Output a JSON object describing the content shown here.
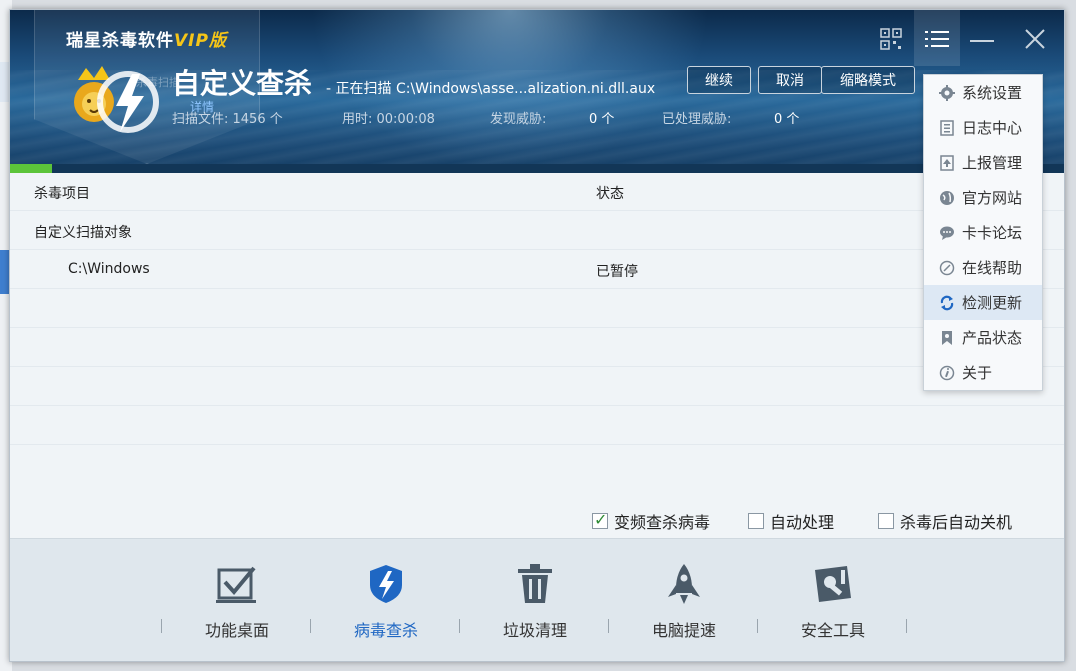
{
  "app": {
    "brand": "瑞星杀毒软件",
    "brand_vip": "VIP版",
    "hidden_text": "杀毒扫描",
    "detail_link": "详情"
  },
  "scan": {
    "title": "自定义查杀",
    "path": "- 正在扫描 C:\\Windows\\asse...alization.ni.dll.aux",
    "files_label": "扫描文件: 1456 个",
    "time_label": "用时: 00:00:08",
    "threats_found_label": "发现威胁:",
    "threats_found_value": "0 个",
    "threats_handled_label": "已处理威胁:",
    "threats_handled_value": "0 个",
    "progress_fraction": 0.04
  },
  "buttons": {
    "continue": "继续",
    "cancel": "取消",
    "mini_mode": "缩略模式"
  },
  "table": {
    "col_item": "杀毒项目",
    "col_status": "状态",
    "rows": [
      {
        "item": "自定义扫描对象",
        "status": ""
      },
      {
        "item": "C:\\Windows",
        "status": "已暂停"
      }
    ]
  },
  "options": {
    "freq": "变频查杀病毒",
    "auto_handle": "自动处理",
    "auto_shutdown": "杀毒后自动关机"
  },
  "nav": [
    {
      "label": "功能桌面",
      "icon": "checkbox-board-icon"
    },
    {
      "label": "病毒查杀",
      "icon": "shield-lightning-icon"
    },
    {
      "label": "垃圾清理",
      "icon": "trash-icon"
    },
    {
      "label": "电脑提速",
      "icon": "rocket-icon"
    },
    {
      "label": "安全工具",
      "icon": "wrench-tool-icon"
    }
  ],
  "menu": [
    {
      "label": "系统设置",
      "icon": "gear-icon"
    },
    {
      "label": "日志中心",
      "icon": "log-icon"
    },
    {
      "label": "上报管理",
      "icon": "upload-icon"
    },
    {
      "label": "官方网站",
      "icon": "globe-icon"
    },
    {
      "label": "卡卡论坛",
      "icon": "chat-icon"
    },
    {
      "label": "在线帮助",
      "icon": "help-icon"
    },
    {
      "label": "检测更新",
      "icon": "refresh-icon"
    },
    {
      "label": "产品状态",
      "icon": "bookmark-icon"
    },
    {
      "label": "关于",
      "icon": "info-icon"
    }
  ],
  "colors": {
    "accent": "#1f67c3",
    "progress": "#5cc43a",
    "vip": "#f5c518"
  }
}
